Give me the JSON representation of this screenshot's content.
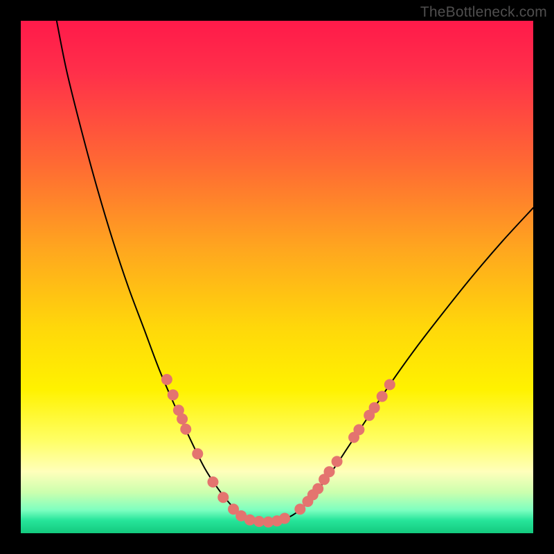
{
  "watermark": "TheBottleneck.com",
  "chart_data": {
    "type": "line",
    "title": "",
    "xlabel": "",
    "ylabel": "",
    "xlim": [
      0,
      100
    ],
    "ylim": [
      0,
      100
    ],
    "grid": false,
    "legend": false,
    "gradient_stops": [
      {
        "pos": 0.0,
        "color": "#ff1a4a"
      },
      {
        "pos": 0.1,
        "color": "#ff2f4a"
      },
      {
        "pos": 0.28,
        "color": "#ff6a33"
      },
      {
        "pos": 0.45,
        "color": "#ffa81e"
      },
      {
        "pos": 0.6,
        "color": "#ffd80a"
      },
      {
        "pos": 0.72,
        "color": "#fff200"
      },
      {
        "pos": 0.82,
        "color": "#ffff66"
      },
      {
        "pos": 0.88,
        "color": "#ffffbb"
      },
      {
        "pos": 0.92,
        "color": "#ccffae"
      },
      {
        "pos": 0.955,
        "color": "#7dffc0"
      },
      {
        "pos": 0.975,
        "color": "#26e59a"
      },
      {
        "pos": 1.0,
        "color": "#14c97e"
      }
    ],
    "series": [
      {
        "name": "bottleneck-curve",
        "stroke": "#000000",
        "stroke_width": 2,
        "points": [
          {
            "x": 7.0,
            "y": 100.0
          },
          {
            "x": 9.0,
            "y": 90.0
          },
          {
            "x": 12.0,
            "y": 78.0
          },
          {
            "x": 15.0,
            "y": 67.0
          },
          {
            "x": 18.0,
            "y": 57.0
          },
          {
            "x": 21.0,
            "y": 48.0
          },
          {
            "x": 24.0,
            "y": 40.0
          },
          {
            "x": 27.0,
            "y": 32.0
          },
          {
            "x": 30.0,
            "y": 25.0
          },
          {
            "x": 33.0,
            "y": 18.5
          },
          {
            "x": 36.0,
            "y": 12.5
          },
          {
            "x": 39.0,
            "y": 8.0
          },
          {
            "x": 41.5,
            "y": 5.0
          },
          {
            "x": 43.5,
            "y": 3.2
          },
          {
            "x": 45.5,
            "y": 2.3
          },
          {
            "x": 48.0,
            "y": 2.2
          },
          {
            "x": 50.5,
            "y": 2.5
          },
          {
            "x": 53.0,
            "y": 3.5
          },
          {
            "x": 55.5,
            "y": 5.5
          },
          {
            "x": 58.0,
            "y": 8.5
          },
          {
            "x": 61.0,
            "y": 12.5
          },
          {
            "x": 64.0,
            "y": 17.0
          },
          {
            "x": 68.0,
            "y": 23.0
          },
          {
            "x": 72.0,
            "y": 29.0
          },
          {
            "x": 77.0,
            "y": 36.0
          },
          {
            "x": 82.0,
            "y": 42.5
          },
          {
            "x": 88.0,
            "y": 50.0
          },
          {
            "x": 94.0,
            "y": 57.0
          },
          {
            "x": 100.0,
            "y": 63.5
          }
        ]
      }
    ],
    "marker_groups": [
      {
        "name": "left-dot-cluster",
        "color": "#e4746f",
        "radius": 8,
        "points": [
          {
            "x": 28.5,
            "y": 30.0
          },
          {
            "x": 29.7,
            "y": 27.0
          },
          {
            "x": 30.8,
            "y": 24.0
          },
          {
            "x": 31.5,
            "y": 22.3
          },
          {
            "x": 32.2,
            "y": 20.3
          },
          {
            "x": 34.5,
            "y": 15.5
          },
          {
            "x": 37.5,
            "y": 10.0
          },
          {
            "x": 39.5,
            "y": 7.0
          },
          {
            "x": 41.5,
            "y": 4.7
          },
          {
            "x": 43.0,
            "y": 3.4
          },
          {
            "x": 44.7,
            "y": 2.6
          },
          {
            "x": 46.5,
            "y": 2.3
          },
          {
            "x": 48.3,
            "y": 2.2
          },
          {
            "x": 50.0,
            "y": 2.4
          },
          {
            "x": 51.5,
            "y": 2.9
          }
        ]
      },
      {
        "name": "right-dot-cluster",
        "color": "#e4746f",
        "radius": 8,
        "points": [
          {
            "x": 54.5,
            "y": 4.7
          },
          {
            "x": 56.0,
            "y": 6.2
          },
          {
            "x": 57.0,
            "y": 7.5
          },
          {
            "x": 58.0,
            "y": 8.7
          },
          {
            "x": 59.2,
            "y": 10.5
          },
          {
            "x": 60.2,
            "y": 12.0
          },
          {
            "x": 61.7,
            "y": 14.0
          },
          {
            "x": 65.0,
            "y": 18.7
          },
          {
            "x": 66.0,
            "y": 20.2
          },
          {
            "x": 68.0,
            "y": 23.0
          },
          {
            "x": 69.0,
            "y": 24.5
          },
          {
            "x": 70.5,
            "y": 26.7
          },
          {
            "x": 72.0,
            "y": 29.0
          }
        ]
      }
    ]
  }
}
